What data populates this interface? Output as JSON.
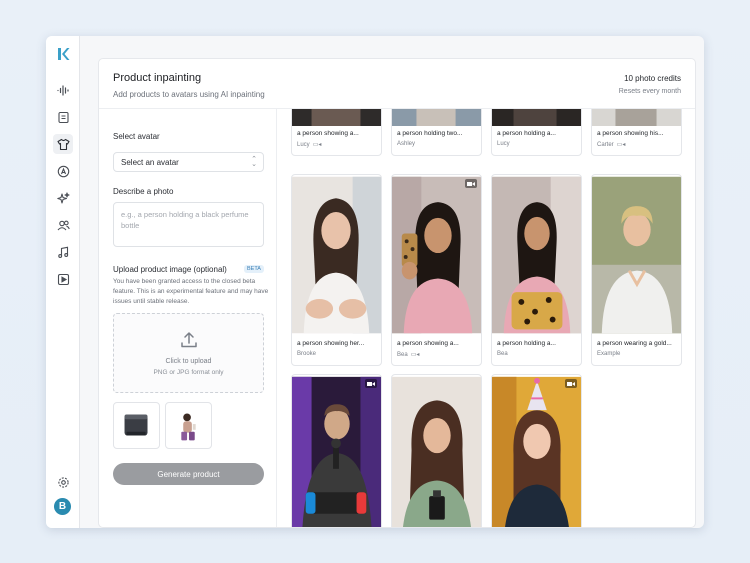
{
  "sidebar": {
    "items": [
      {
        "icon": "logo-k-icon"
      },
      {
        "icon": "waveform-icon"
      },
      {
        "icon": "document-icon"
      },
      {
        "icon": "tshirt-icon",
        "active": true
      },
      {
        "icon": "a-circle-icon"
      },
      {
        "icon": "sparkles-icon"
      },
      {
        "icon": "users-icon"
      },
      {
        "icon": "music-note-icon"
      },
      {
        "icon": "play-square-icon"
      }
    ],
    "settings_icon": "gear-icon",
    "avatar_initial": "B"
  },
  "header": {
    "title": "Product inpainting",
    "subtitle": "Add products to avatars using AI inpainting",
    "credits": "10 photo credits",
    "resets": "Resets every month"
  },
  "form": {
    "select_avatar_label": "Select avatar",
    "select_avatar_value": "Select an avatar",
    "describe_label": "Describe a photo",
    "describe_placeholder": "e.g., a person holding a black perfume bottle",
    "upload_label": "Upload product image (optional)",
    "beta_badge": "BETA",
    "beta_desc": "You have been granted access to the closed beta feature. This is an experimental feature and may have issues until stable release.",
    "dropzone_text": "Click to upload",
    "dropzone_hint": "PNG or JPG format only",
    "generate_button": "Generate product"
  },
  "cards": [
    {
      "caption": "a person showing a...",
      "author": "Lucy",
      "video": true
    },
    {
      "caption": "a person holding two...",
      "author": "Ashley",
      "video": false
    },
    {
      "caption": "a person holding a...",
      "author": "Lucy",
      "video": false
    },
    {
      "caption": "a person showing his...",
      "author": "Carter",
      "video": true
    },
    {
      "caption": "a person showing her...",
      "author": "Brooke",
      "video": false
    },
    {
      "caption": "a person showing a...",
      "author": "Bea",
      "video": true
    },
    {
      "caption": "a person holding a...",
      "author": "Bea",
      "video": false
    },
    {
      "caption": "a person wearing a gold...",
      "author": "Example",
      "video": false
    }
  ],
  "colors": {
    "accent": "#2a8bb0",
    "button_disabled": "#9a9ca0",
    "beta": "#3a7fb5"
  }
}
